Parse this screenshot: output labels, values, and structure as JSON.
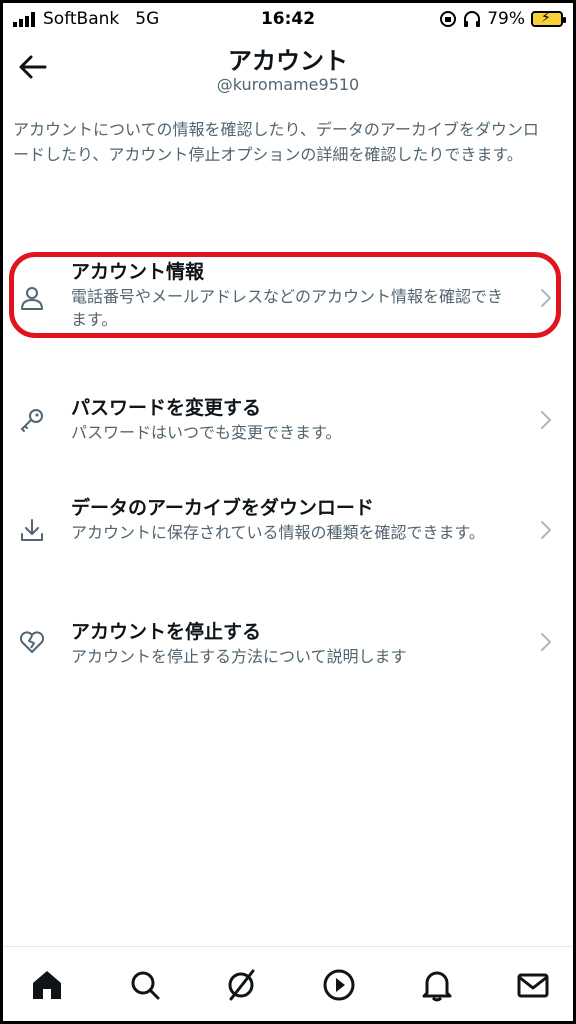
{
  "status_bar": {
    "carrier": "SoftBank",
    "network": "5G",
    "time": "16:42",
    "battery": "79%"
  },
  "header": {
    "title": "アカウント",
    "handle": "@kuromame9510"
  },
  "description": "アカウントについての情報を確認したり、データのアーカイブをダウンロードしたり、アカウント停止オプションの詳細を確認したりできます。",
  "items": [
    {
      "icon": "person-icon",
      "label": "アカウント情報",
      "desc": "電話番号やメールアドレスなどのアカウント情報を確認できます。"
    },
    {
      "icon": "key-icon",
      "label": "パスワードを変更する",
      "desc": "パスワードはいつでも変更できます。"
    },
    {
      "icon": "download-icon",
      "label": "データのアーカイブをダウンロード",
      "desc": "アカウントに保存されている情報の種類を確認できます。"
    },
    {
      "icon": "broken-heart-icon",
      "label": "アカウントを停止する",
      "desc": "アカウントを停止する方法について説明します"
    }
  ],
  "bottom_nav": [
    "home-icon",
    "search-icon",
    "communities-icon",
    "play-icon",
    "bell-icon",
    "mail-icon"
  ],
  "colors": {
    "text": "#0f1419",
    "secondary": "#536471",
    "highlight": "#e0141e"
  }
}
